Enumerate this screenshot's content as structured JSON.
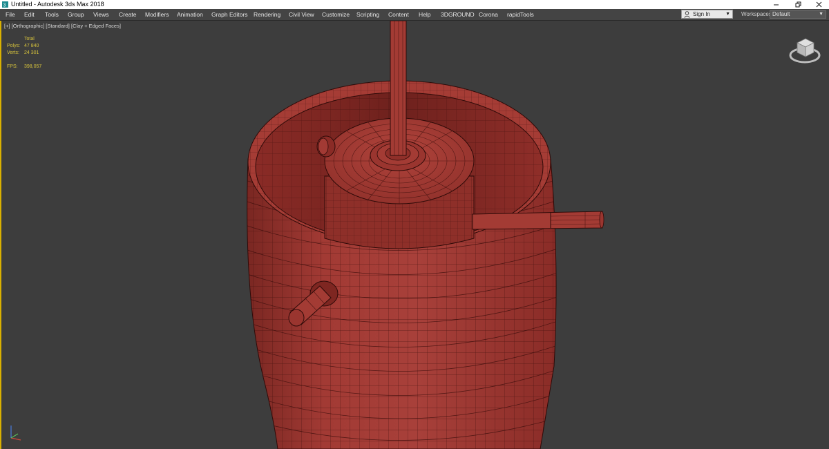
{
  "window": {
    "title": "Untitled - Autodesk 3ds Max 2018",
    "app_icon": "3dsmax-logo-icon",
    "controls": [
      "minimize-icon",
      "restore-icon",
      "close-icon"
    ]
  },
  "menu": {
    "items": [
      "File",
      "Edit",
      "Tools",
      "Group",
      "Views",
      "Create",
      "Modifiers",
      "Animation",
      "Graph Editors",
      "Rendering",
      "Civil View",
      "Customize",
      "Scripting",
      "Content",
      "Help",
      "3DGROUND",
      "Corona",
      "rapidTools"
    ]
  },
  "account": {
    "signin_label": "Sign In",
    "icon": "user-icon"
  },
  "workspaces": {
    "label": "Workspaces:",
    "value": "Default"
  },
  "viewport": {
    "labels": [
      "[+]",
      "[Orthographic]",
      "[Standard]",
      "[Clay + Edged Faces]"
    ],
    "stats": {
      "header": "Total",
      "polys_label": "Polys:",
      "polys_value": "47 840",
      "verts_label": "Verts:",
      "verts_value": "24 301",
      "fps_label": "FPS:",
      "fps_value": "398,057"
    },
    "colors": {
      "background": "#3d3d3d",
      "border": "#d9b000",
      "clay": "#a23a34",
      "wire": "#3a0d0b",
      "stats_text": "#d8c43c"
    },
    "icons": [
      "viewcube-icon",
      "axis-tripod-icon"
    ]
  }
}
